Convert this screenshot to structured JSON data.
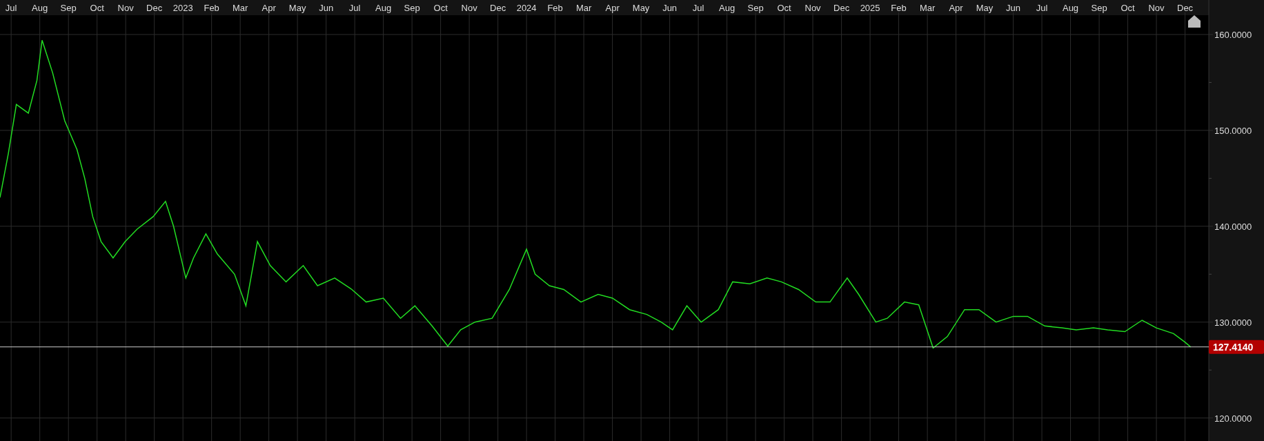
{
  "chart_data": {
    "type": "line",
    "x": [
      2022.4675,
      2022.4917,
      2022.515,
      2022.55,
      2022.575,
      2022.59,
      2022.6208,
      2022.6558,
      2022.6917,
      2022.7142,
      2022.7375,
      2022.7617,
      2022.7967,
      2022.8317,
      2022.8667,
      2022.9133,
      2022.9492,
      2022.9725,
      2023.0083,
      2023.0308,
      2023.0667,
      2023.1,
      2023.15,
      2023.1833,
      2023.2167,
      2023.2542,
      2023.3,
      2023.35,
      2023.3917,
      2023.4417,
      2023.4917,
      2023.5333,
      2023.5833,
      2023.6333,
      2023.675,
      2023.725,
      2023.7708,
      2023.8083,
      2023.85,
      2023.9,
      2023.95,
      2024,
      2024.025,
      2024.0667,
      2024.1083,
      2024.1583,
      2024.2083,
      2024.25,
      2024.3,
      2024.35,
      2024.3917,
      2024.425,
      2024.4667,
      2024.5083,
      2024.5583,
      2024.6,
      2024.65,
      2024.7,
      2024.7417,
      2024.7917,
      2024.8417,
      2024.8833,
      2024.9333,
      2024.9667,
      2025.0167,
      2025.05,
      2025.1,
      2025.1417,
      2025.1833,
      2025.225,
      2025.275,
      2025.3167,
      2025.3667,
      2025.4167,
      2025.4583,
      2025.5083,
      2025.5583,
      2025.6,
      2025.65,
      2025.6917,
      2025.7417,
      2025.7917,
      2025.8333,
      2025.8833,
      2025.9167,
      2025.9333
    ],
    "series": [
      {
        "color": "#22dd22",
        "values": [
          143,
          147.6,
          152.7,
          151.8,
          155.2,
          159.4,
          156,
          151,
          148,
          145,
          141,
          138.4,
          136.7,
          138.4,
          139.7,
          141,
          142.6,
          140,
          134.6,
          136.7,
          139.2,
          137.1,
          135,
          131.7,
          138.4,
          135.9,
          134.2,
          135.9,
          133.8,
          134.6,
          133.4,
          132.1,
          132.5,
          130.4,
          131.7,
          129.6,
          127.5,
          129.2,
          130,
          130.4,
          133.4,
          137.6,
          135,
          133.8,
          133.4,
          132.1,
          132.9,
          132.5,
          131.3,
          130.8,
          130,
          129.2,
          131.7,
          130,
          131.3,
          134.2,
          134,
          134.6,
          134.2,
          133.4,
          132.1,
          132.1,
          134.6,
          132.9,
          130,
          130.4,
          132.1,
          131.8,
          127.3,
          128.5,
          131.3,
          131.3,
          130,
          130.6,
          130.6,
          129.6,
          129.4,
          129.2,
          129.4,
          129.2,
          129,
          130.2,
          129.4,
          128.8,
          127.9,
          127.4
        ]
      }
    ],
    "xlim": [
      2022.4675,
      2026.1465
    ],
    "ylim": [
      117.6,
      163.6
    ],
    "grid": true,
    "ref_lines": [
      {
        "axis": "y",
        "value": 127.414,
        "label": "127.4140",
        "color": "#cccccc"
      }
    ],
    "xticks": [
      {
        "value": 2022.5,
        "label": "Jul"
      },
      {
        "value": 2022.5833,
        "label": "Aug"
      },
      {
        "value": 2022.6667,
        "label": "Sep"
      },
      {
        "value": 2022.75,
        "label": "Oct"
      },
      {
        "value": 2022.8333,
        "label": "Nov"
      },
      {
        "value": 2022.9167,
        "label": "Dec"
      },
      {
        "value": 2023,
        "label": "2023"
      },
      {
        "value": 2023.0833,
        "label": "Feb"
      },
      {
        "value": 2023.1667,
        "label": "Mar"
      },
      {
        "value": 2023.25,
        "label": "Apr"
      },
      {
        "value": 2023.3333,
        "label": "May"
      },
      {
        "value": 2023.4167,
        "label": "Jun"
      },
      {
        "value": 2023.5,
        "label": "Jul"
      },
      {
        "value": 2023.5833,
        "label": "Aug"
      },
      {
        "value": 2023.6667,
        "label": "Sep"
      },
      {
        "value": 2023.75,
        "label": "Oct"
      },
      {
        "value": 2023.8333,
        "label": "Nov"
      },
      {
        "value": 2023.9167,
        "label": "Dec"
      },
      {
        "value": 2024,
        "label": "2024"
      },
      {
        "value": 2024.0833,
        "label": "Feb"
      },
      {
        "value": 2024.1667,
        "label": "Mar"
      },
      {
        "value": 2024.25,
        "label": "Apr"
      },
      {
        "value": 2024.3333,
        "label": "May"
      },
      {
        "value": 2024.4167,
        "label": "Jun"
      },
      {
        "value": 2024.5,
        "label": "Jul"
      },
      {
        "value": 2024.5833,
        "label": "Aug"
      },
      {
        "value": 2024.6667,
        "label": "Sep"
      },
      {
        "value": 2024.75,
        "label": "Oct"
      },
      {
        "value": 2024.8333,
        "label": "Nov"
      },
      {
        "value": 2024.9167,
        "label": "Dec"
      },
      {
        "value": 2025,
        "label": "2025"
      },
      {
        "value": 2025.0833,
        "label": "Feb"
      },
      {
        "value": 2025.1667,
        "label": "Mar"
      },
      {
        "value": 2025.25,
        "label": "Apr"
      },
      {
        "value": 2025.3333,
        "label": "May"
      },
      {
        "value": 2025.4167,
        "label": "Jun"
      },
      {
        "value": 2025.5,
        "label": "Jul"
      },
      {
        "value": 2025.5833,
        "label": "Aug"
      },
      {
        "value": 2025.6667,
        "label": "Sep"
      },
      {
        "value": 2025.75,
        "label": "Oct"
      },
      {
        "value": 2025.8333,
        "label": "Nov"
      },
      {
        "value": 2025.9167,
        "label": "Dec"
      }
    ],
    "yticks": [
      {
        "value": 120,
        "label": "120.0000"
      },
      {
        "value": 130,
        "label": "130.0000"
      },
      {
        "value": 140,
        "label": "140.0000"
      },
      {
        "value": 150,
        "label": "150.0000"
      },
      {
        "value": 160,
        "label": "160.0000"
      }
    ]
  }
}
